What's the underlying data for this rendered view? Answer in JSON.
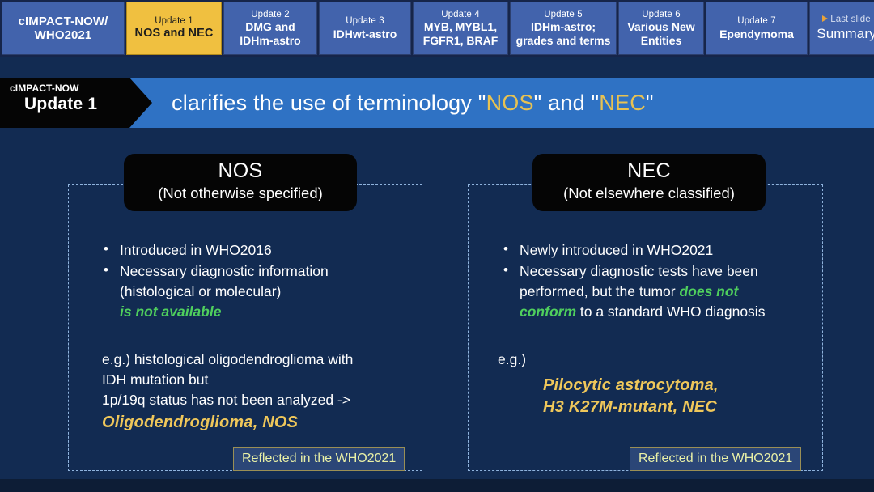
{
  "tabs": [
    {
      "name": "tab-cimpact-who2021",
      "line1": "cIMPACT-NOW/",
      "line2": "WHO2021",
      "style": "first",
      "active": false,
      "width": "w0"
    },
    {
      "name": "tab-update-1",
      "line1": "Update 1",
      "line2": "NOS and NEC",
      "style": "normal",
      "active": true,
      "width": "w1"
    },
    {
      "name": "tab-update-2",
      "line1": "Update 2",
      "line2": "DMG and",
      "line3": "IDHm-astro",
      "style": "three",
      "active": false,
      "width": "w2"
    },
    {
      "name": "tab-update-3",
      "line1": "Update 3",
      "line2": "IDHwt-astro",
      "style": "normal",
      "active": false,
      "width": "w3"
    },
    {
      "name": "tab-update-4",
      "line1": "Update 4",
      "line2": "MYB, MYBL1,",
      "line3": "FGFR1, BRAF",
      "style": "three",
      "active": false,
      "width": "w4"
    },
    {
      "name": "tab-update-5",
      "line1": "Update 5",
      "line2": "IDHm-astro;",
      "line3": "grades and terms",
      "style": "three",
      "active": false,
      "width": "w5"
    },
    {
      "name": "tab-update-6",
      "line1": "Update 6",
      "line2": "Various New",
      "line3": "Entities",
      "style": "three",
      "active": false,
      "width": "w6"
    },
    {
      "name": "tab-update-7",
      "line1": "Update 7",
      "line2": "Ependymoma",
      "style": "normal",
      "active": false,
      "width": "w7"
    },
    {
      "name": "tab-summary",
      "line1": "Last slide",
      "line2": "Summary",
      "style": "summary",
      "active": false,
      "width": "w8"
    }
  ],
  "banner": {
    "tag_small": "cIMPACT-NOW",
    "tag_big": "Update 1",
    "text_prefix": "clarifies the use of terminology \"",
    "highlight_1": "NOS",
    "text_middle": "\" and \"",
    "highlight_2": "NEC",
    "text_suffix": "\""
  },
  "left_panel": {
    "title_abbr": "NOS",
    "title_full": "(Not otherwise specified)",
    "bullet_1": "Introduced in WHO2016",
    "bullet_2_part1": "Necessary diagnostic information",
    "bullet_2_part2": "(histological or molecular)",
    "bullet_2_highlight": "is not available",
    "example_line1": "e.g.) histological oligodendroglioma with",
    "example_line2": "IDH mutation but",
    "example_line3": "1p/19q status has not been analyzed ->",
    "example_result": "Oligodendroglioma, NOS",
    "reflect_label": "Reflected in the WHO2021"
  },
  "right_panel": {
    "title_abbr": "NEC",
    "title_full": "(Not elsewhere classified)",
    "bullet_1": "Newly introduced in WHO2021",
    "bullet_2_part1": "Necessary diagnostic tests have been",
    "bullet_2_part2": "performed, but the tumor ",
    "bullet_2_highlight_a": "does not",
    "bullet_2_highlight_b": "conform",
    "bullet_2_part3": " to a standard WHO diagnosis",
    "example_prefix": "e.g.)",
    "example_result_line1": "Pilocytic astrocytoma,",
    "example_result_line2": "H3 K27M-mutant, NEC",
    "reflect_label": "Reflected in the WHO2021"
  },
  "colors": {
    "slide_background": "#122b52",
    "tab_inactive": "#4263ac",
    "tab_active": "#f0c040",
    "banner_blue": "#2f72c4",
    "banner_tag_black": "#050505",
    "gold_highlight": "#e8c252",
    "green_highlight": "#4fcf5d",
    "reflect_text": "#e9f0a6",
    "dashed_border": "#8fb3dd",
    "play_icon": "#e8a33a"
  },
  "icons": {
    "play_triangle": "play-triangle-icon"
  }
}
